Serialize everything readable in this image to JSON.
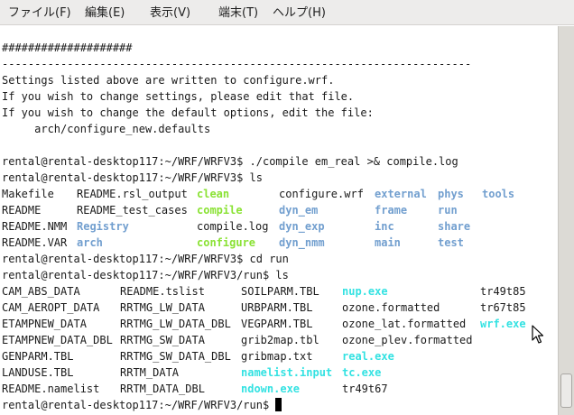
{
  "menu": [
    "ファイル(F)",
    "編集(E)",
    "表示(V)",
    "端末(T)",
    "ヘルプ(H)"
  ],
  "lines": [
    {
      "text": "####################"
    },
    {
      "text": "------------------------------------------------------------------------"
    },
    {
      "text": "Settings listed above are written to configure.wrf."
    },
    {
      "text": "If you wish to change settings, please edit that file."
    },
    {
      "text": "If you wish to change the default options, edit the file:"
    },
    {
      "text": "     arch/configure_new.defaults"
    },
    {
      "text": ""
    },
    {
      "text": "rental@rental-desktop117:~/WRF/WRFV3$ ./compile em_real >& compile.log"
    },
    {
      "text": "rental@rental-desktop117:~/WRF/WRFV3$ ls"
    },
    {
      "cells": [
        {
          "t": "Makefile"
        },
        {
          "t": "README.rsl_output"
        },
        {
          "t": "clean",
          "c": "exe"
        },
        {
          "t": "configure.wrf"
        },
        {
          "t": "external",
          "c": "dir"
        },
        {
          "t": "phys",
          "c": "dir"
        },
        {
          "t": "tools",
          "c": "dir"
        }
      ]
    },
    {
      "cells": [
        {
          "t": "README"
        },
        {
          "t": "README_test_cases"
        },
        {
          "t": "compile",
          "c": "exe"
        },
        {
          "t": "dyn_em",
          "c": "dir"
        },
        {
          "t": "frame",
          "c": "dir"
        },
        {
          "t": "run",
          "c": "dir"
        }
      ]
    },
    {
      "cells": [
        {
          "t": "README.NMM"
        },
        {
          "t": "Registry",
          "c": "dir"
        },
        {
          "t": "compile.log"
        },
        {
          "t": "dyn_exp",
          "c": "dir"
        },
        {
          "t": "inc",
          "c": "dir"
        },
        {
          "t": "share",
          "c": "dir"
        }
      ]
    },
    {
      "cells": [
        {
          "t": "README.VAR"
        },
        {
          "t": "arch",
          "c": "dir"
        },
        {
          "t": "configure",
          "c": "exe"
        },
        {
          "t": "dyn_nmm",
          "c": "dir"
        },
        {
          "t": "main",
          "c": "dir"
        },
        {
          "t": "test",
          "c": "dir"
        }
      ]
    },
    {
      "text": "rental@rental-desktop117:~/WRF/WRFV3$ cd run"
    },
    {
      "text": "rental@rental-desktop117:~/WRF/WRFV3/run$ ls"
    },
    {
      "cells2": [
        {
          "t": "CAM_ABS_DATA"
        },
        {
          "t": "README.tslist"
        },
        {
          "t": "SOILPARM.TBL"
        },
        {
          "t": "nup.exe",
          "c": "cyan"
        },
        {
          "t": "tr49t85"
        }
      ]
    },
    {
      "cells2": [
        {
          "t": "CAM_AEROPT_DATA"
        },
        {
          "t": "RRTMG_LW_DATA"
        },
        {
          "t": "URBPARM.TBL"
        },
        {
          "t": "ozone.formatted"
        },
        {
          "t": "tr67t85"
        }
      ]
    },
    {
      "cells2": [
        {
          "t": "ETAMPNEW_DATA"
        },
        {
          "t": "RRTMG_LW_DATA_DBL"
        },
        {
          "t": "VEGPARM.TBL"
        },
        {
          "t": "ozone_lat.formatted"
        },
        {
          "t": "wrf.exe",
          "c": "cyan"
        }
      ]
    },
    {
      "cells2": [
        {
          "t": "ETAMPNEW_DATA_DBL"
        },
        {
          "t": "RRTMG_SW_DATA"
        },
        {
          "t": "grib2map.tbl"
        },
        {
          "t": "ozone_plev.formatted"
        }
      ]
    },
    {
      "cells2": [
        {
          "t": "GENPARM.TBL"
        },
        {
          "t": "RRTMG_SW_DATA_DBL"
        },
        {
          "t": "gribmap.txt"
        },
        {
          "t": "real.exe",
          "c": "cyan"
        }
      ]
    },
    {
      "cells2": [
        {
          "t": "LANDUSE.TBL"
        },
        {
          "t": "RRTM_DATA"
        },
        {
          "t": "namelist.input",
          "c": "cyan"
        },
        {
          "t": "tc.exe",
          "c": "cyan"
        }
      ]
    },
    {
      "cells2": [
        {
          "t": "README.namelist"
        },
        {
          "t": "RRTM_DATA_DBL"
        },
        {
          "t": "ndown.exe",
          "c": "cyan"
        },
        {
          "t": "tr49t67"
        }
      ]
    },
    {
      "text": "rental@rental-desktop117:~/WRF/WRFV3/run$ ",
      "cursor": true
    }
  ]
}
